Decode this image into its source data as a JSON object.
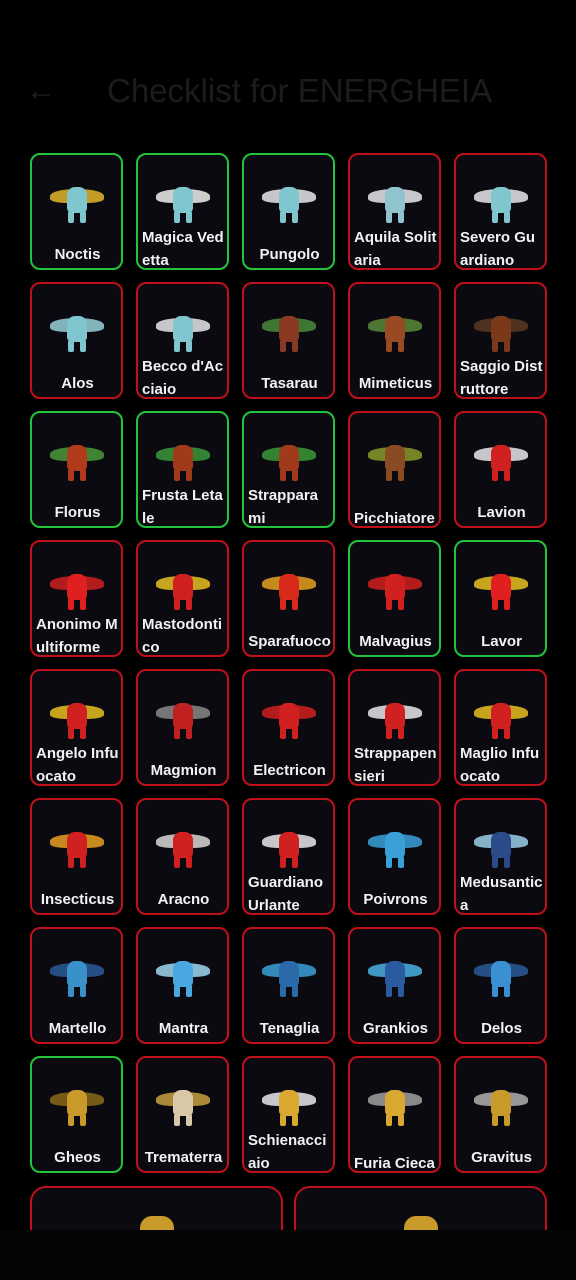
{
  "header": {
    "back_icon": "arrow-left-icon",
    "title": "Checklist for ENERGHEIA"
  },
  "colors": {
    "owned_border": "#22c43a",
    "missing_border": "#c0101a",
    "card_bg": "#0b0a10"
  },
  "cards": [
    {
      "name": "Noctis",
      "owned": true,
      "color": "#7fc6cf",
      "accent": "#e4b62a"
    },
    {
      "name": "Magica Vedetta",
      "owned": true,
      "color": "#7fc6cf",
      "accent": "#f0f0f0"
    },
    {
      "name": "Pungolo",
      "owned": true,
      "color": "#7fc6cf",
      "accent": "#e8e8ec"
    },
    {
      "name": "Aquila Solitaria",
      "owned": false,
      "color": "#8fc4cf",
      "accent": "#e8e8ec"
    },
    {
      "name": "Severo Guardiano",
      "owned": false,
      "color": "#7fc6cf",
      "accent": "#e8e8ec"
    },
    {
      "name": "Alos",
      "owned": false,
      "color": "#7fc6cf",
      "accent": "#9ad0d8"
    },
    {
      "name": "Becco d'Acciaio",
      "owned": false,
      "color": "#7fc6cf",
      "accent": "#e8e8ec"
    },
    {
      "name": "Tasarau",
      "owned": false,
      "color": "#8a3a22",
      "accent": "#4a8a3a"
    },
    {
      "name": "Mimeticus",
      "owned": false,
      "color": "#9a4a22",
      "accent": "#5a8a3a"
    },
    {
      "name": "Saggio Distruttore",
      "owned": false,
      "color": "#7a3a1a",
      "accent": "#5a3a22"
    },
    {
      "name": "Florus",
      "owned": true,
      "color": "#b03a1a",
      "accent": "#4a9a3a"
    },
    {
      "name": "Frusta Letale",
      "owned": true,
      "color": "#a03a1a",
      "accent": "#3a9a3a"
    },
    {
      "name": "Strapparami",
      "owned": true,
      "color": "#a03a1a",
      "accent": "#3a9a3a"
    },
    {
      "name": "Picchiatore",
      "owned": false,
      "color": "#8a4a22",
      "accent": "#8a9a2a"
    },
    {
      "name": "Lavion",
      "owned": false,
      "color": "#d02020",
      "accent": "#e8e8ec"
    },
    {
      "name": "Anonimo Multiforme",
      "owned": false,
      "color": "#e02020",
      "accent": "#d02020"
    },
    {
      "name": "Mastodontico",
      "owned": false,
      "color": "#d02020",
      "accent": "#e8c020"
    },
    {
      "name": "Sparafuoco",
      "owned": false,
      "color": "#d82a1a",
      "accent": "#e8a020"
    },
    {
      "name": "Malvagius",
      "owned": true,
      "color": "#d02020",
      "accent": "#d02020"
    },
    {
      "name": "Lavor",
      "owned": true,
      "color": "#e02020",
      "accent": "#e8c020"
    },
    {
      "name": "Angelo Infuocato",
      "owned": false,
      "color": "#d02020",
      "accent": "#e8c020"
    },
    {
      "name": "Magmion",
      "owned": false,
      "color": "#c02020",
      "accent": "#8a8a8a"
    },
    {
      "name": "Electricon",
      "owned": false,
      "color": "#d02020",
      "accent": "#d02020"
    },
    {
      "name": "Strappapensieri",
      "owned": false,
      "color": "#d02020",
      "accent": "#e8e8ec"
    },
    {
      "name": "Maglio Infuocato",
      "owned": false,
      "color": "#d02020",
      "accent": "#e8c020"
    },
    {
      "name": "Insecticus",
      "owned": false,
      "color": "#d02020",
      "accent": "#e8a020"
    },
    {
      "name": "Aracno",
      "owned": false,
      "color": "#d02020",
      "accent": "#d8d8d8"
    },
    {
      "name": "Guardiano Urlante",
      "owned": false,
      "color": "#d02020",
      "accent": "#e8e8ec"
    },
    {
      "name": "Poivrons",
      "owned": false,
      "color": "#3aa0d8",
      "accent": "#3aa0d8"
    },
    {
      "name": "Medusantica",
      "owned": false,
      "color": "#2a4a8a",
      "accent": "#9ad0e8"
    },
    {
      "name": "Martello",
      "owned": false,
      "color": "#3a90c8",
      "accent": "#2a5a9a"
    },
    {
      "name": "Mantra",
      "owned": false,
      "color": "#4aa8e0",
      "accent": "#a0d8f0"
    },
    {
      "name": "Tenaglia",
      "owned": false,
      "color": "#2a6aa8",
      "accent": "#3aa0d8"
    },
    {
      "name": "Grankios",
      "owned": false,
      "color": "#2a5aa0",
      "accent": "#4ab0e0"
    },
    {
      "name": "Delos",
      "owned": false,
      "color": "#3a90d0",
      "accent": "#2a5a9a"
    },
    {
      "name": "Gheos",
      "owned": true,
      "color": "#c89a2a",
      "accent": "#8a6a1a"
    },
    {
      "name": "Trematerra",
      "owned": false,
      "color": "#d8c8a8",
      "accent": "#c8a040"
    },
    {
      "name": "Schienacciaio",
      "owned": false,
      "color": "#d8a830",
      "accent": "#e8e8ec"
    },
    {
      "name": "Furia Cieca",
      "owned": false,
      "color": "#d8a830",
      "accent": "#a0a0a0"
    },
    {
      "name": "Gravitus",
      "owned": false,
      "color": "#c89a2a",
      "accent": "#b0b0b0"
    }
  ],
  "wide_cards": [
    {
      "owned": false,
      "color": "#c89a2a"
    },
    {
      "owned": false,
      "color": "#c89a2a"
    }
  ]
}
